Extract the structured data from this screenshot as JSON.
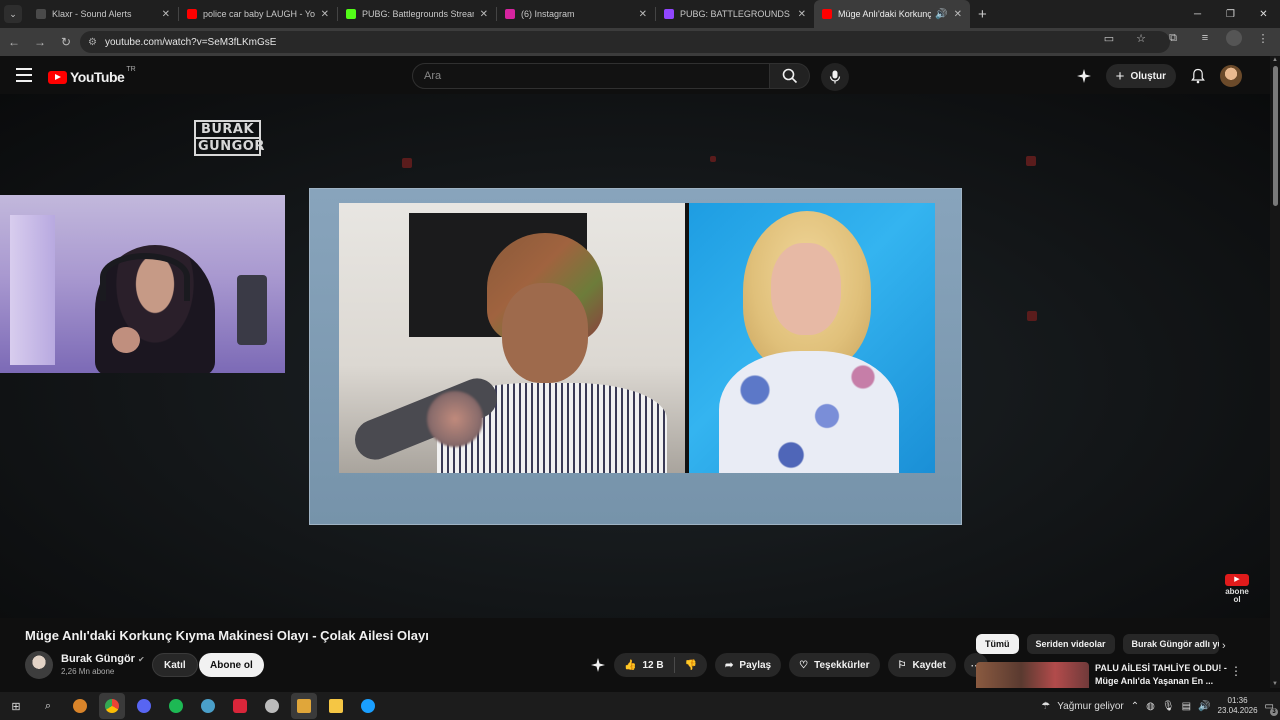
{
  "browser": {
    "tabs": [
      {
        "title": "Klaxr - Sound Alerts",
        "icon": "klaxr-favicon",
        "color": "#4a4a4a"
      },
      {
        "title": "police car baby LAUGH - YouTu",
        "icon": "youtube-favicon",
        "color": "#ff0000"
      },
      {
        "title": "PUBG: Battlegrounds Streaming",
        "icon": "kick-favicon",
        "color": "#53fc18"
      },
      {
        "title": "(6) Instagram",
        "icon": "instagram-favicon",
        "color": "#d6249f"
      },
      {
        "title": "PUBG: BATTLEGROUNDS - Twitc",
        "icon": "twitch-favicon",
        "color": "#9146ff"
      },
      {
        "title": "Müge Anlı'daki Korkunç Kıy",
        "icon": "youtube-favicon",
        "color": "#ff0000",
        "active": true
      }
    ],
    "url": "youtube.com/watch?v=SeM3fLKmGsE"
  },
  "youtube": {
    "logo": "YouTube",
    "country": "TR",
    "search_placeholder": "Ara",
    "create_label": "Oluştur"
  },
  "player": {
    "overlay_logo_line1": "BURAK",
    "overlay_logo_line2": "GÜNGÖR",
    "abone_label": "abone ol"
  },
  "video": {
    "title": "Müge Anlı'daki Korkunç Kıyma Makinesi Olayı - Çolak Ailesi Olayı",
    "channel": "Burak Güngör",
    "subscribers": "2,26 Mn abone",
    "join_label": "Katıl",
    "subscribe_label": "Abone ol",
    "likes": "12 B",
    "share_label": "Paylaş",
    "thanks_label": "Teşekkürler",
    "save_label": "Kaydet"
  },
  "sidebar": {
    "chips": [
      "Tümü",
      "Seriden videolar",
      "Burak Güngör adlı yü"
    ],
    "recommendation_line1": "PALU AİLESİ TAHLİYE OLDU! -",
    "recommendation_line2": "Müge Anlı'da Yaşanan En ..."
  },
  "taskbar": {
    "weather": "Yağmur geliyor",
    "time": "01:36",
    "date": "23.04.2026",
    "notifications": "3"
  }
}
